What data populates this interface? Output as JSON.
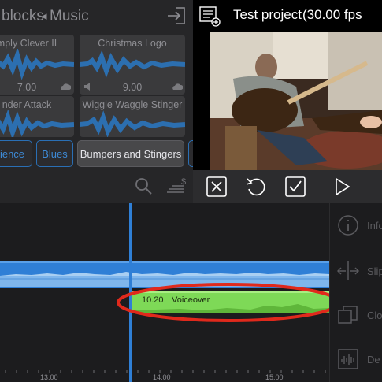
{
  "library": {
    "breadcrumb_blocks": "blocks",
    "breadcrumb_back_glyph": "◂",
    "breadcrumb_music": "Music",
    "tiles": [
      {
        "title": "mply Clever II",
        "value": "7.00"
      },
      {
        "title": "Christmas Logo",
        "value": "9.00"
      },
      {
        "title": "nder Attack",
        "value": ""
      },
      {
        "title": "Wiggle Waggle Stinger",
        "value": ""
      }
    ],
    "categories": [
      {
        "label": "ience",
        "selected": false
      },
      {
        "label": "Blues",
        "selected": false
      },
      {
        "label": "Bumpers and Stingers",
        "selected": true
      }
    ]
  },
  "preview": {
    "project_title": "Test project",
    "fps": "(30.00 fps"
  },
  "timeline": {
    "clip_time": "10.20",
    "clip_name": "Voiceover",
    "ticks": [
      "13.00",
      "14.00",
      "15.00"
    ]
  },
  "inspector": {
    "items": [
      "Info",
      "Slip",
      "Clo",
      "De"
    ]
  },
  "colors": {
    "accent": "#2f7fd6",
    "voiceover": "#7ed957",
    "annotation": "#e0291c"
  }
}
